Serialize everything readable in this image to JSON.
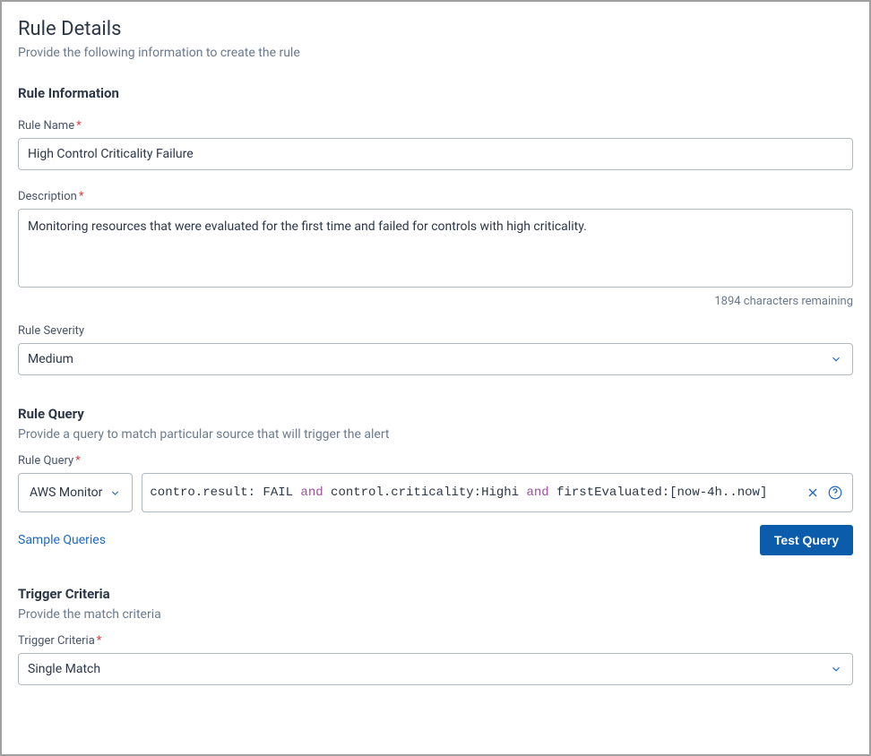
{
  "header": {
    "title": "Rule Details",
    "subtitle": "Provide the following information to create the rule"
  },
  "rule_info": {
    "section_title": "Rule Information",
    "name_label": "Rule Name",
    "name_value": "High Control Criticality Failure",
    "desc_label": "Description",
    "desc_value": "Monitoring resources that were evaluated for the first time and failed for controls with high criticality.",
    "chars_remaining": "1894 characters remaining",
    "severity_label": "Rule Severity",
    "severity_value": "Medium"
  },
  "rule_query": {
    "section_title": "Rule Query",
    "section_subtitle": "Provide a query to match particular source that will trigger the alert",
    "query_label": "Rule Query",
    "source_value": "AWS Monitor",
    "query_parts": [
      {
        "t": "contro.result: FAIL ",
        "kw": false
      },
      {
        "t": "and",
        "kw": true
      },
      {
        "t": " control.criticality:Highi ",
        "kw": false
      },
      {
        "t": "and",
        "kw": true
      },
      {
        "t": " firstEvaluated:[now-4h..now]",
        "kw": false
      }
    ],
    "sample_link": "Sample Queries",
    "test_btn": "Test Query"
  },
  "trigger": {
    "section_title": "Trigger Criteria",
    "section_subtitle": "Provide the match criteria",
    "label": "Trigger Criteria",
    "value": "Single Match"
  }
}
